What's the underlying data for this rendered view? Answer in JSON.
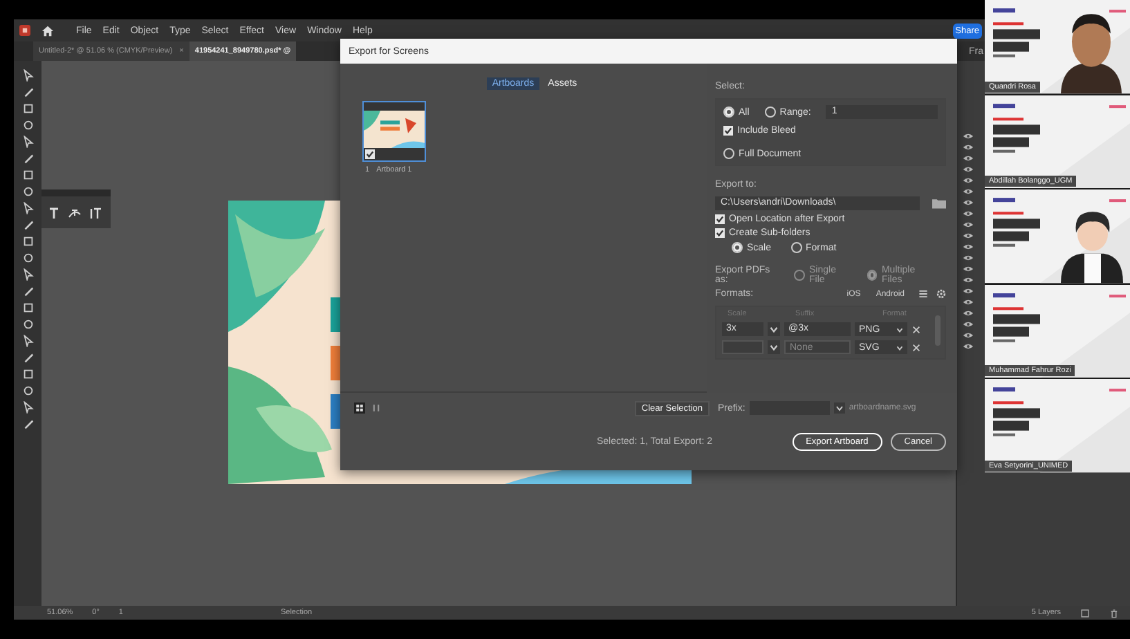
{
  "menu": [
    "File",
    "Edit",
    "Object",
    "Type",
    "Select",
    "Effect",
    "View",
    "Window",
    "Help"
  ],
  "share_button": "Share",
  "panel_tab": "Fra",
  "doc_tabs": [
    {
      "label": "Untitled-2* @ 51.06 % (CMYK/Preview)",
      "selected": false,
      "close": "×"
    },
    {
      "label": "41954241_8949780.psd* @",
      "selected": true
    }
  ],
  "dialog": {
    "title": "Export for Screens",
    "tabs": [
      {
        "label": "Artboards",
        "selected": true
      },
      {
        "label": "Assets",
        "selected": false
      }
    ],
    "artboards": [
      {
        "number": "1",
        "name": "Artboard 1",
        "checked": true
      }
    ],
    "select": {
      "label": "Select:",
      "all": {
        "label": "All",
        "selected": true
      },
      "range": {
        "label": "Range:",
        "selected": false,
        "value": "1"
      },
      "include_bleed": {
        "label": "Include Bleed",
        "checked": true
      },
      "full_document": {
        "label": "Full Document",
        "selected": false
      }
    },
    "export_to": {
      "label": "Export to:",
      "path": "C:\\Users\\andri\\Downloads\\",
      "open_location": {
        "label": "Open Location after Export",
        "checked": true
      },
      "create_subfolders": {
        "label": "Create Sub-folders",
        "checked": true
      },
      "subfolder_modes": [
        {
          "label": "Scale",
          "selected": true
        },
        {
          "label": "Format",
          "selected": false
        }
      ]
    },
    "export_pdfs": {
      "label": "Export PDFs as:",
      "options": [
        {
          "label": "Single File",
          "selected": false
        },
        {
          "label": "Multiple Files",
          "selected": true
        }
      ],
      "disabled": true
    },
    "formats": {
      "label": "Formats:",
      "presets": [
        "iOS",
        "Android"
      ],
      "columns": [
        "Scale",
        "Suffix",
        "Format"
      ],
      "rows": [
        {
          "scale": "3x",
          "suffix": "@3x",
          "format": "PNG",
          "disabled": false
        },
        {
          "scale": "",
          "suffix": "None",
          "format": "SVG",
          "disabled": true
        }
      ]
    },
    "clear_selection": "Clear Selection",
    "prefix": {
      "label": "Prefix:",
      "preview": "artboardname.svg"
    },
    "summary": "Selected: 1, Total Export: 2",
    "buttons": [
      {
        "label": "Export Artboard",
        "primary": true
      },
      {
        "label": "Cancel",
        "primary": false
      }
    ]
  },
  "status_bar": {
    "zoom": "51.06%",
    "rotation": "0°",
    "artboard": "1",
    "tool": "Selection",
    "layers": "5 Layers"
  },
  "video_tiles": [
    {
      "kind": "camera",
      "name": "Quandri Rosa"
    },
    {
      "kind": "slide",
      "name": "Abdillah Bolanggo_UGM"
    },
    {
      "kind": "avatar"
    },
    {
      "kind": "slide",
      "name": "Muhammad Fahrur Rozi"
    },
    {
      "kind": "slide",
      "name": "Eva Setyorini_UNIMED"
    }
  ]
}
